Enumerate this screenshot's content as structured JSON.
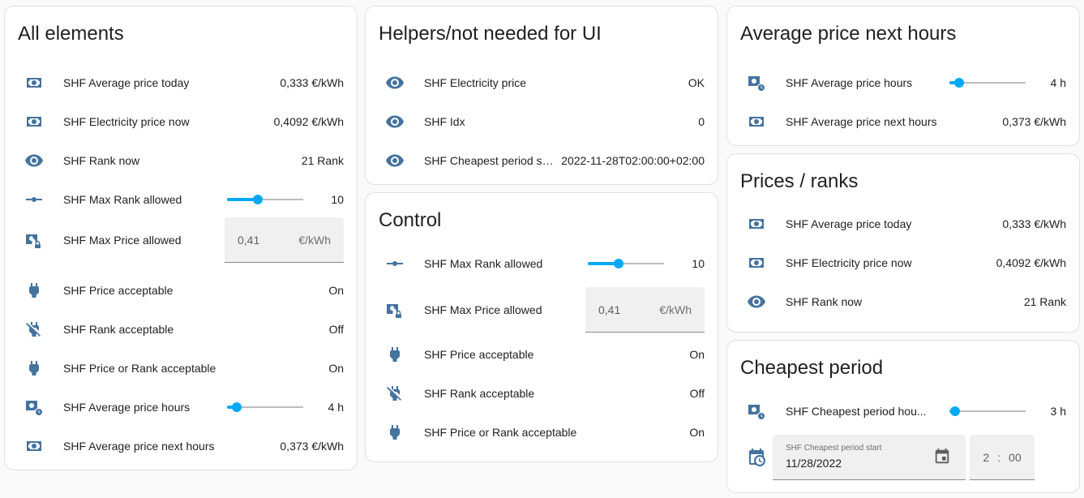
{
  "cards": {
    "all": {
      "title": "All elements",
      "rows": [
        {
          "name": "SHF Average price today",
          "state": "0,333 €/kWh",
          "icon": "cash-icon"
        },
        {
          "name": "SHF Electricity price now",
          "state": "0,4092 €/kWh",
          "icon": "cash-icon"
        },
        {
          "name": "SHF Rank now",
          "state": "21 Rank",
          "icon": "eye-icon"
        },
        {
          "name": "SHF Max Rank allowed",
          "state": "10",
          "icon": "ray-vertex-icon",
          "slider": 0.4
        },
        {
          "name": "SHF Max Price allowed",
          "value": "0,41",
          "unit": "€/kWh",
          "icon": "cash-lock-icon"
        },
        {
          "name": "SHF Price acceptable",
          "state": "On",
          "icon": "power-plug-icon"
        },
        {
          "name": "SHF Rank acceptable",
          "state": "Off",
          "icon": "power-plug-off-icon"
        },
        {
          "name": "SHF Price or Rank acceptable",
          "state": "On",
          "icon": "power-plug-icon"
        },
        {
          "name": "SHF Average price hours",
          "state": "4 h",
          "icon": "cash-clock-icon",
          "slider": 0.13
        },
        {
          "name": "SHF Average price next hours",
          "state": "0,373 €/kWh",
          "icon": "cash-icon"
        }
      ]
    },
    "helpers": {
      "title": "Helpers/not needed for UI",
      "rows": [
        {
          "name": "SHF Electricity price",
          "state": "OK",
          "icon": "eye-icon"
        },
        {
          "name": "SHF Idx",
          "state": "0",
          "icon": "eye-icon"
        },
        {
          "name": "SHF Cheapest period sta...",
          "state": "2022-11-28T02:00:00+02:00",
          "icon": "eye-icon"
        }
      ]
    },
    "control": {
      "title": "Control",
      "rows": [
        {
          "name": "SHF Max Rank allowed",
          "state": "10",
          "icon": "ray-vertex-icon",
          "slider": 0.4
        },
        {
          "name": "SHF Max Price allowed",
          "value": "0,41",
          "unit": "€/kWh",
          "icon": "cash-lock-icon"
        },
        {
          "name": "SHF Price acceptable",
          "state": "On",
          "icon": "power-plug-icon"
        },
        {
          "name": "SHF Rank acceptable",
          "state": "Off",
          "icon": "power-plug-off-icon"
        },
        {
          "name": "SHF Price or Rank acceptable",
          "state": "On",
          "icon": "power-plug-icon"
        }
      ]
    },
    "avg": {
      "title": "Average price next hours",
      "rows": [
        {
          "name": "SHF Average price hours",
          "state": "4 h",
          "icon": "cash-clock-icon",
          "slider": 0.13
        },
        {
          "name": "SHF Average price next hours",
          "state": "0,373 €/kWh",
          "icon": "cash-icon"
        }
      ]
    },
    "prices": {
      "title": "Prices / ranks",
      "rows": [
        {
          "name": "SHF Average price today",
          "state": "0,333 €/kWh",
          "icon": "cash-icon"
        },
        {
          "name": "SHF Electricity price now",
          "state": "0,4092 €/kWh",
          "icon": "cash-icon"
        },
        {
          "name": "SHF Rank now",
          "state": "21 Rank",
          "icon": "eye-icon"
        }
      ]
    },
    "cheapest": {
      "title": "Cheapest period",
      "rows": [
        {
          "name": "SHF Cheapest period hou...",
          "state": "3 h",
          "icon": "cash-clock-icon",
          "slider": 0.07
        }
      ],
      "datetime": {
        "icon": "calendar-clock-icon",
        "label": "SHF Cheapest period start",
        "date": "11/28/2022",
        "hour": "2",
        "sep": ":",
        "minute": "00"
      }
    }
  },
  "colors": {
    "icon": "#44739e",
    "accent": "#03a9f4"
  }
}
